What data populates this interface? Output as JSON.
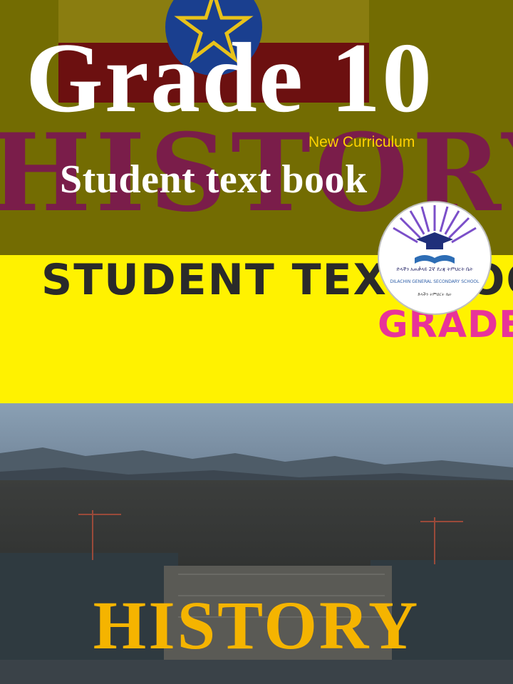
{
  "cover": {
    "grade_title": "Grade 10",
    "curriculum_note": "New Curriculum",
    "book_type": "Student text book",
    "subject": "HISTORY"
  },
  "background_art": {
    "poster_word": "HISTORY",
    "poster_line": "STUDENT TEXT BOO",
    "poster_grade": "GRADE"
  },
  "logo": {
    "amharic_line": "ድላችን አጠቃላይ 2ኛ ደረጃ ትምህርት ቤት",
    "school_name": "DILACHIN GENERAL SECONDARY SCHOOL",
    "motto": "ድላችን ትምህርት ቤት"
  },
  "colors": {
    "olive_band": "#736c02",
    "title_white": "#ffffff",
    "curriculum_gold": "#ffd200",
    "subject_gold": "#f5b400",
    "poster_yellow": "#fff200",
    "poster_pink": "#e8339a"
  }
}
